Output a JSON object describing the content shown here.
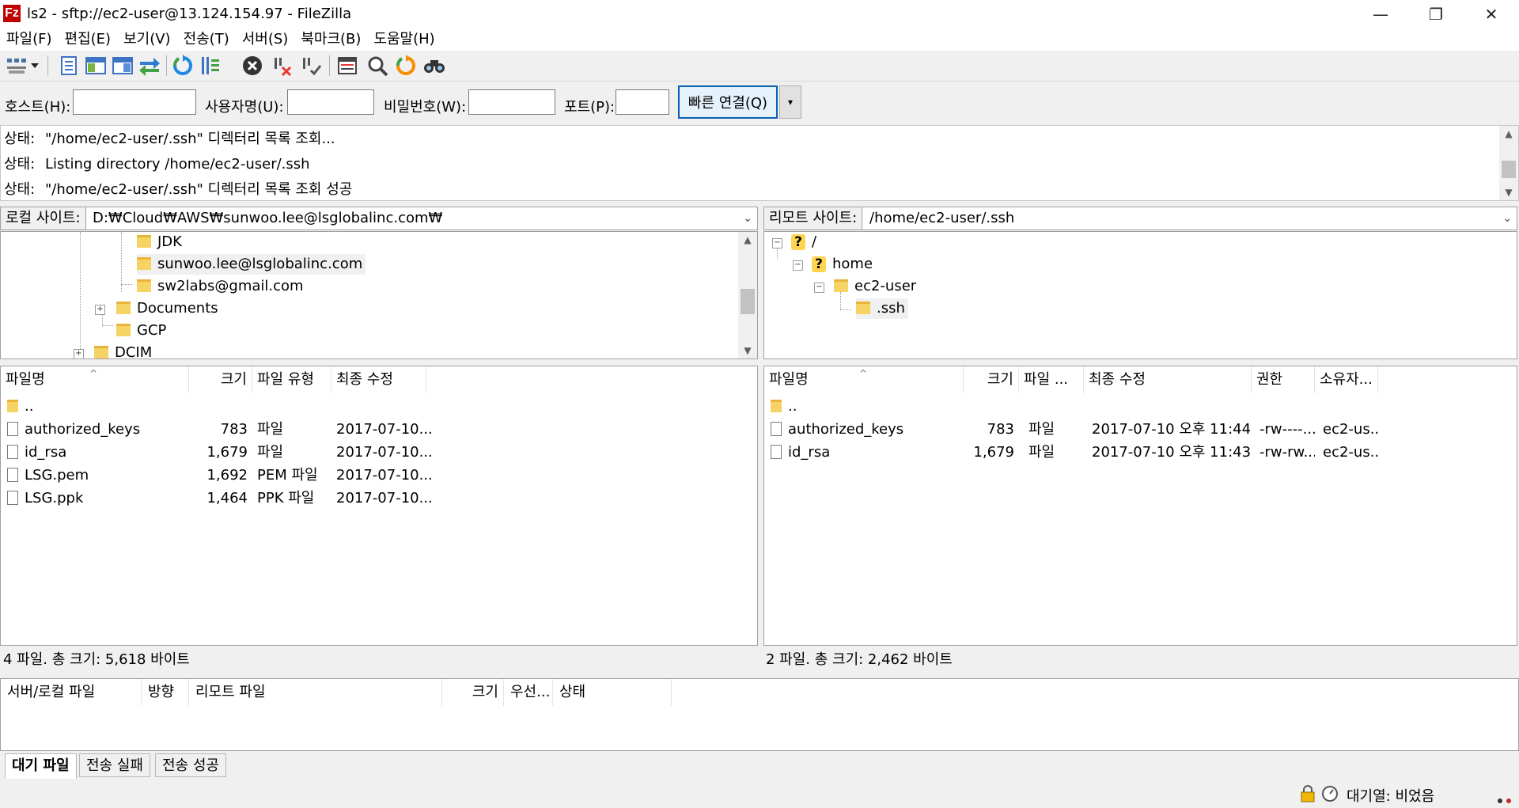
{
  "window": {
    "title": "ls2 - sftp://ec2-user@13.124.154.97 - FileZilla",
    "app_logo": "Fz",
    "minimize": "—",
    "restore": "❐",
    "close": "✕"
  },
  "menu": [
    "파일(F)",
    "편집(E)",
    "보기(V)",
    "전송(T)",
    "서버(S)",
    "북마크(B)",
    "도움말(H)"
  ],
  "toolbar": {
    "icons": [
      "site-manager-icon",
      "dropdown-arrow-icon",
      "toggle-log-icon",
      "toggle-local-tree-icon",
      "toggle-remote-tree-icon",
      "toggle-queue-icon",
      "refresh-icon",
      "process-queue-icon",
      "cancel-icon",
      "disconnect-icon",
      "reconnect-icon",
      "directory-compare-icon",
      "filter-icon",
      "sync-browse-icon",
      "search-icon"
    ]
  },
  "quickconnect": {
    "host_label": "호스트(H):",
    "user_label": "사용자명(U):",
    "pass_label": "비밀번호(W):",
    "port_label": "포트(P):",
    "host_value": "",
    "user_value": "",
    "pass_value": "",
    "port_value": "",
    "connect_label": "빠른 연결(Q)",
    "dropdown_glyph": "▾"
  },
  "log": [
    {
      "key": "상태:",
      "text": "\"/home/ec2-user/.ssh\" 디렉터리 목록 조회..."
    },
    {
      "key": "상태:",
      "text": "Listing directory /home/ec2-user/.ssh"
    },
    {
      "key": "상태:",
      "text": "\"/home/ec2-user/.ssh\" 디렉터리 목록 조회 성공"
    }
  ],
  "local": {
    "site_label": "로컬 사이트:",
    "path": "D:₩Cloud₩AWS₩sunwoo.lee@lsglobalinc.com₩",
    "tree": [
      {
        "label": "JDK"
      },
      {
        "label": "sunwoo.lee@lsglobalinc.com"
      },
      {
        "label": "sw2labs@gmail.com"
      },
      {
        "label": "Documents",
        "expander": "+"
      },
      {
        "label": "GCP"
      },
      {
        "label": "DCIM",
        "expander": "+"
      }
    ],
    "columns": {
      "name": "파일명",
      "size": "크기",
      "type": "파일 유형",
      "modified": "최종 수정"
    },
    "files": [
      {
        "name": "..",
        "size": "",
        "type": "",
        "modified": "",
        "kind": "folder"
      },
      {
        "name": "authorized_keys",
        "size": "783",
        "type": "파일",
        "modified": "2017-07-10...",
        "kind": "file"
      },
      {
        "name": "id_rsa",
        "size": "1,679",
        "type": "파일",
        "modified": "2017-07-10...",
        "kind": "file"
      },
      {
        "name": "LSG.pem",
        "size": "1,692",
        "type": "PEM 파일",
        "modified": "2017-07-10...",
        "kind": "file"
      },
      {
        "name": "LSG.ppk",
        "size": "1,464",
        "type": "PPK 파일",
        "modified": "2017-07-10...",
        "kind": "file"
      }
    ],
    "status": "4 파일. 총 크기: 5,618 바이트"
  },
  "remote": {
    "site_label": "리모트 사이트:",
    "path": "/home/ec2-user/.ssh",
    "tree": [
      {
        "label": "/",
        "icon": "?"
      },
      {
        "label": "home",
        "icon": "?"
      },
      {
        "label": "ec2-user"
      },
      {
        "label": ".ssh"
      }
    ],
    "columns": {
      "name": "파일명",
      "size": "크기",
      "type": "파일 ...",
      "modified": "최종 수정",
      "perms": "권한",
      "owner": "소유자..."
    },
    "files": [
      {
        "name": "..",
        "size": "",
        "type": "",
        "modified": "",
        "perms": "",
        "owner": "",
        "kind": "folder"
      },
      {
        "name": "authorized_keys",
        "size": "783",
        "type": "파일",
        "modified": "2017-07-10 오후 11:44...",
        "perms": "-rw----...",
        "owner": "ec2-us...",
        "kind": "file"
      },
      {
        "name": "id_rsa",
        "size": "1,679",
        "type": "파일",
        "modified": "2017-07-10 오후 11:43...",
        "perms": "-rw-rw...",
        "owner": "ec2-us...",
        "kind": "file"
      }
    ],
    "status": "2 파일. 총 크기: 2,462 바이트"
  },
  "queue": {
    "columns": {
      "server_local": "서버/로컬 파일",
      "direction": "방향",
      "remote": "리모트 파일",
      "size": "크기",
      "priority": "우선...",
      "status": "상태"
    }
  },
  "tabs": [
    "대기 파일",
    "전송 실패",
    "전송 성공"
  ],
  "statusbar": {
    "queue": "대기열: 비었음"
  }
}
